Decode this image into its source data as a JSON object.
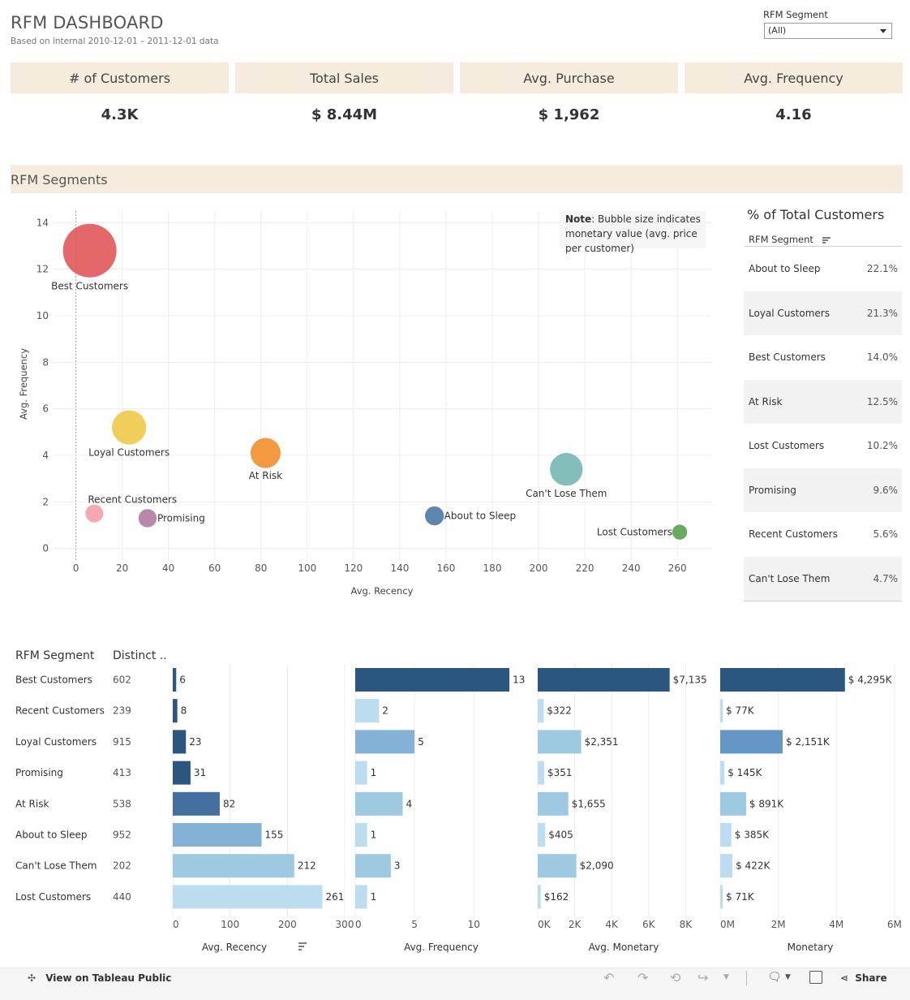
{
  "header": {
    "title": "RFM DASHBOARD",
    "subtitle": "Based on internal 2010-12-01 – 2011-12-01 data"
  },
  "filter": {
    "label": "RFM Segment",
    "value": "(All)"
  },
  "kpis": [
    {
      "label": "# of Customers",
      "value": "4.3K"
    },
    {
      "label": "Total Sales",
      "value": "$ 8.44M"
    },
    {
      "label": "Avg. Purchase",
      "value": "$ 1,962"
    },
    {
      "label": "Avg. Frequency",
      "value": "4.16"
    }
  ],
  "section_title": "RFM Segments",
  "table": {
    "title": "% of Total Customers",
    "column": "RFM Segment",
    "rows": [
      {
        "name": "About to Sleep",
        "pct": "22.1%"
      },
      {
        "name": "Loyal Customers",
        "pct": "21.3%"
      },
      {
        "name": "Best Customers",
        "pct": "14.0%"
      },
      {
        "name": "At Risk",
        "pct": "12.5%"
      },
      {
        "name": "Lost Customers",
        "pct": "10.2%"
      },
      {
        "name": "Promising",
        "pct": "9.6%"
      },
      {
        "name": "Recent Customers",
        "pct": "5.6%"
      },
      {
        "name": "Can't Lose Them",
        "pct": "4.7%"
      }
    ]
  },
  "chart_data": [
    {
      "type": "scatter",
      "xlabel": "Avg. Recency",
      "ylabel": "Avg. Frequency",
      "xlim": [
        -10,
        275
      ],
      "ylim": [
        -0.5,
        14.5
      ],
      "xticks": [
        0,
        20,
        40,
        60,
        80,
        100,
        120,
        140,
        160,
        180,
        200,
        220,
        240,
        260
      ],
      "yticks": [
        0,
        2,
        4,
        6,
        8,
        10,
        12,
        14
      ],
      "grid": true,
      "note_bold": "Note",
      "note_text": ": Bubble size indicates monetary value (avg. price per customer)",
      "points": [
        {
          "label": "Best Customers",
          "x": 6,
          "y": 12.8,
          "monetary": 7135,
          "color": "#e15759"
        },
        {
          "label": "Loyal Customers",
          "x": 23,
          "y": 5.2,
          "monetary": 2351,
          "color": "#edc948"
        },
        {
          "label": "At Risk",
          "x": 82,
          "y": 4.1,
          "monetary": 1655,
          "color": "#f28e2b"
        },
        {
          "label": "Can't Lose Them",
          "x": 212,
          "y": 3.4,
          "monetary": 2090,
          "color": "#76b7b2"
        },
        {
          "label": "Recent Customers",
          "x": 8,
          "y": 1.5,
          "monetary": 322,
          "color": "#f59fa7"
        },
        {
          "label": "Promising",
          "x": 31,
          "y": 1.3,
          "monetary": 351,
          "color": "#b07aa1"
        },
        {
          "label": "About to Sleep",
          "x": 155,
          "y": 1.4,
          "monetary": 405,
          "color": "#4e79a7"
        },
        {
          "label": "Lost Customers",
          "x": 261,
          "y": 0.7,
          "monetary": 162,
          "color": "#59a14f"
        }
      ]
    },
    {
      "type": "bar",
      "orientation": "horizontal",
      "row_header": "RFM Segment",
      "count_header": "Distinct ..",
      "categories": [
        "Best Customers",
        "Recent Customers",
        "Loyal Customers",
        "Promising",
        "At Risk",
        "About to Sleep",
        "Can't Lose Them",
        "Lost Customers"
      ],
      "distinct_counts": [
        "602",
        "239",
        "915",
        "413",
        "538",
        "952",
        "202",
        "440"
      ],
      "panels": [
        {
          "name": "Avg. Recency",
          "values": [
            6,
            8,
            23,
            31,
            82,
            155,
            212,
            261
          ],
          "labels": [
            "6",
            "8",
            "23",
            "31",
            "82",
            "155",
            "212",
            "261"
          ],
          "xlim": [
            0,
            300
          ],
          "ticks": [
            "0",
            "100",
            "200",
            "300"
          ],
          "tickvals": [
            0,
            100,
            200,
            300
          ]
        },
        {
          "name": "Avg. Frequency",
          "values": [
            13,
            2,
            5,
            1,
            4,
            1,
            3,
            1
          ],
          "labels": [
            "13",
            "2",
            "5",
            "1",
            "4",
            "1",
            "3",
            "1"
          ],
          "xlim": [
            0,
            14.5
          ],
          "ticks": [
            "0",
            "5",
            "10"
          ],
          "tickvals": [
            0,
            5,
            10
          ]
        },
        {
          "name": "Avg. Monetary",
          "values": [
            7135,
            322,
            2351,
            351,
            1655,
            405,
            2090,
            162
          ],
          "labels": [
            "$7,135",
            "$322",
            "$2,351",
            "$351",
            "$1,655",
            "$405",
            "$2,090",
            "$162"
          ],
          "xlim": [
            0,
            9300
          ],
          "ticks": [
            "0K",
            "2K",
            "4K",
            "6K",
            "8K"
          ],
          "tickvals": [
            0,
            2000,
            4000,
            6000,
            8000
          ]
        },
        {
          "name": "Monetary",
          "values": [
            4295,
            77,
            2151,
            145,
            891,
            385,
            422,
            71
          ],
          "labels": [
            "$ 4,295K",
            "$ 77K",
            "$ 2,151K",
            "$ 145K",
            "$ 891K",
            "$ 385K",
            "$ 422K",
            "$ 71K"
          ],
          "xlim": [
            0,
            6200
          ],
          "ticks": [
            "0M",
            "2M",
            "4M",
            "6M"
          ],
          "tickvals": [
            0,
            2000,
            4000,
            6000
          ]
        }
      ]
    }
  ],
  "footer": {
    "view_link": "View on Tableau Public",
    "share": "Share"
  }
}
